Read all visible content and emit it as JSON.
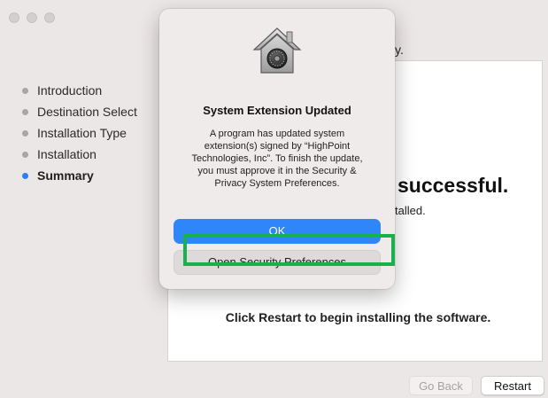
{
  "window": {
    "traffic_lights": [
      "close",
      "minimize",
      "zoom"
    ]
  },
  "sidebar": {
    "steps": [
      {
        "label": "Introduction",
        "current": false
      },
      {
        "label": "Destination Select",
        "current": false
      },
      {
        "label": "Installation Type",
        "current": false
      },
      {
        "label": "Installation",
        "current": false
      },
      {
        "label": "Summary",
        "current": true
      }
    ]
  },
  "main": {
    "top_message_fragment": "ully.",
    "headline_fragment": "successful.",
    "sub_fragment": "talled.",
    "restart_note": "Click Restart to begin installing the software."
  },
  "buttons": {
    "go_back": "Go Back",
    "restart": "Restart"
  },
  "dialog": {
    "icon": "security-lock-house-icon",
    "title": "System Extension Updated",
    "body": "A program has updated system\nextension(s) signed by “HighPoint\nTechnologies, Inc”. To finish the update,\nyou must approve it in the Security &\nPrivacy System Preferences.",
    "ok_label": "OK",
    "secondary_label": "Open Security Preferences"
  },
  "annotation": {
    "highlight_color": "#18b14b"
  }
}
